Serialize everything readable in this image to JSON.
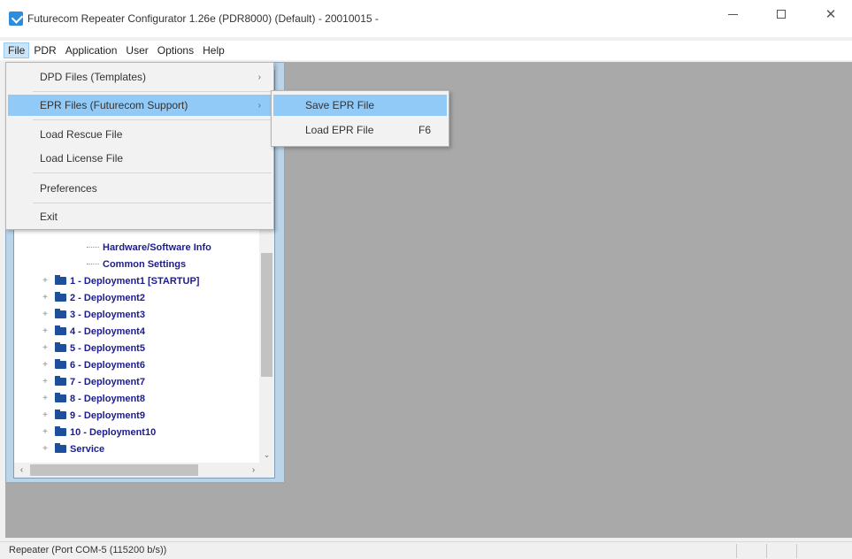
{
  "window": {
    "title": "Futurecom Repeater Configurator 1.26e (PDR8000) (Default) - 20010015 -",
    "minimize_label": "—",
    "maximize_label": "☐",
    "close_label": "✕"
  },
  "menubar": {
    "items": [
      {
        "label": "File"
      },
      {
        "label": "PDR"
      },
      {
        "label": "Application"
      },
      {
        "label": "User"
      },
      {
        "label": "Options"
      },
      {
        "label": "Help"
      }
    ]
  },
  "file_menu": {
    "items": [
      {
        "label": "DPD Files (Templates)",
        "submenu_arrow": "›"
      },
      {
        "label": "EPR Files (Futurecom Support)",
        "submenu_arrow": "›"
      },
      {
        "label": "Load Rescue File"
      },
      {
        "label": "Load License File"
      },
      {
        "label": "Preferences"
      },
      {
        "label": "Exit"
      }
    ]
  },
  "epr_submenu": {
    "items": [
      {
        "label": "Save EPR File",
        "shortcut": ""
      },
      {
        "label": "Load EPR File",
        "shortcut": "F6"
      }
    ]
  },
  "tree": {
    "leaves": [
      {
        "label": "Hardware/Software Info"
      },
      {
        "label": "Common Settings"
      }
    ],
    "folders": [
      {
        "label": "1 - Deployment1 [STARTUP]"
      },
      {
        "label": "2 - Deployment2"
      },
      {
        "label": "3 - Deployment3"
      },
      {
        "label": "4 - Deployment4"
      },
      {
        "label": "5 - Deployment5"
      },
      {
        "label": "6 - Deployment6"
      },
      {
        "label": "7 - Deployment7"
      },
      {
        "label": "8 - Deployment8"
      },
      {
        "label": "9 - Deployment9"
      },
      {
        "label": "10 - Deployment10"
      },
      {
        "label": "Service"
      }
    ],
    "expander_symbol": "+"
  },
  "statusbar": {
    "text": "Repeater (Port COM-5 (115200 b/s))"
  },
  "colors": {
    "highlight": "#91c9f7",
    "tree_text": "#1c1c8c",
    "client_bg": "#a9a9a9"
  }
}
